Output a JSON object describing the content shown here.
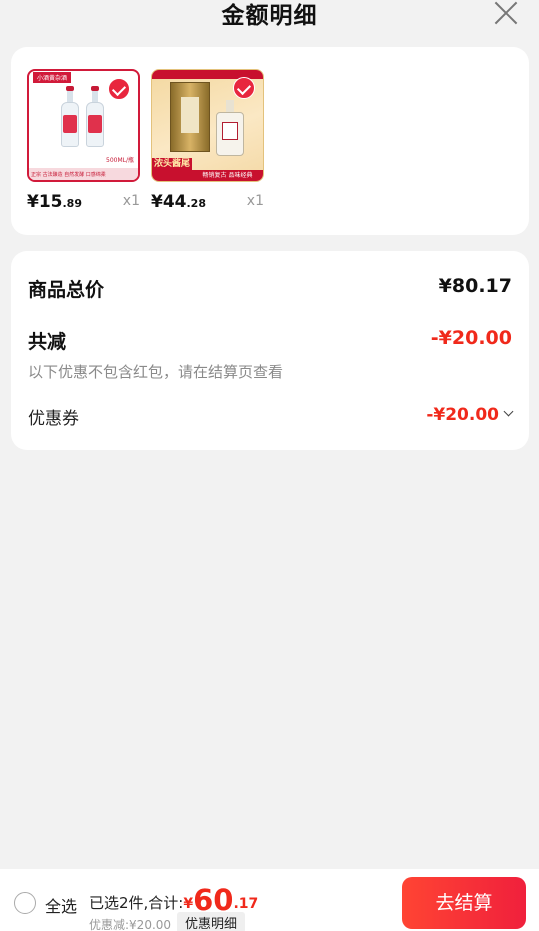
{
  "header": {
    "title": "金额明细"
  },
  "products": [
    {
      "image_top_label": "小酒黄杂酒",
      "image_volume": "500ML/瓶",
      "image_band": "正宗 古法酿造 自然发酵 口感绵柔",
      "price_int": "¥15",
      "price_dec": ".89",
      "qty": "x1",
      "selected": true
    },
    {
      "image_tag": "浓头酱尾",
      "image_slogan": "畅销复古 品味经典",
      "price_int": "¥44",
      "price_dec": ".28",
      "qty": "x1",
      "selected": true
    }
  ],
  "summary": {
    "total_label": "商品总价",
    "total_value": "¥80.17",
    "reduce_label": "共减",
    "reduce_value": "-¥20.00",
    "note": "以下优惠不包含红包，请在结算页查看",
    "coupon_label": "优惠券",
    "coupon_value": "-¥20.00"
  },
  "footer": {
    "select_all": "全选",
    "selected_text": "已选2件,合计:",
    "currency": "¥",
    "total_int": "60",
    "total_dec": ".17",
    "discount_text": "优惠减:¥20.00",
    "detail_label": "优惠明细",
    "checkout_label": "去结算"
  },
  "colors": {
    "accent": "#f0291b",
    "checkout_start": "#ff4433",
    "checkout_end": "#f0203c"
  },
  "icons": {
    "close": "close-icon",
    "check": "check-icon",
    "chevron": "chevron-down-icon"
  }
}
